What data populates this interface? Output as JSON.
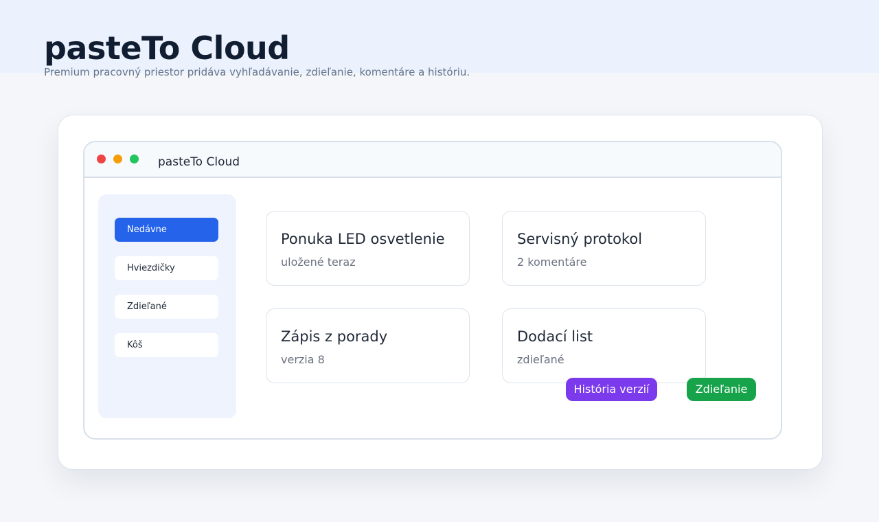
{
  "header": {
    "title": "pasteTo Cloud",
    "subtitle": "Premium pracovný priestor pridáva vyhľadávanie, zdieľanie, komentáre a históriu."
  },
  "window": {
    "title": "pasteTo Cloud"
  },
  "sidebar": {
    "items": [
      {
        "label": "Nedávne",
        "active": true
      },
      {
        "label": "Hviezdičky",
        "active": false
      },
      {
        "label": "Zdieľané",
        "active": false
      },
      {
        "label": "Kôš",
        "active": false
      }
    ]
  },
  "documents": [
    {
      "title": "Ponuka LED osvetlenie",
      "meta": "uložené teraz"
    },
    {
      "title": "Servisný protokol",
      "meta": "2 komentáre"
    },
    {
      "title": "Zápis z porady",
      "meta": "verzia 8"
    },
    {
      "title": "Dodací list",
      "meta": "zdieľané"
    }
  ],
  "actions": {
    "history_label": "História verzií",
    "share_label": "Zdieľanie"
  },
  "colors": {
    "accent": "#2563eb",
    "history": "#7c3aed",
    "share": "#16a34a",
    "dot_red": "#ef4444",
    "dot_yellow": "#f59e0b",
    "dot_green": "#22c55e"
  }
}
